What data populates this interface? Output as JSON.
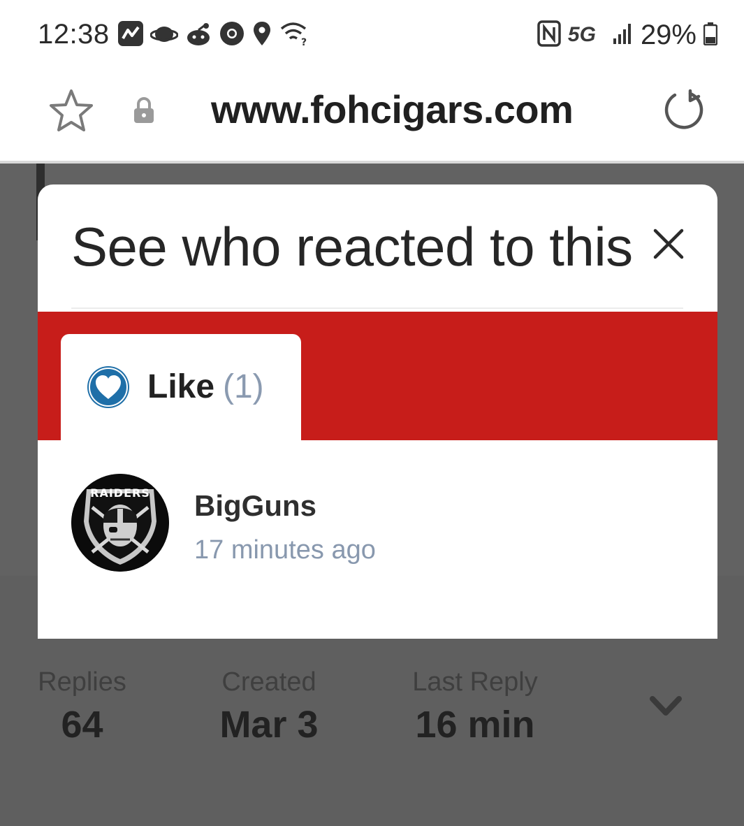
{
  "status_bar": {
    "time": "12:38",
    "left_icons": [
      "activity-app-icon",
      "planet-app-icon",
      "reddit-icon",
      "chrome-icon",
      "location-pin-icon",
      "wifi-question-icon"
    ],
    "network": "5G",
    "battery": "29%",
    "right_icons": [
      "nfc-icon",
      "signal-icon",
      "battery-icon"
    ]
  },
  "browser": {
    "url": "www.fohcigars.com"
  },
  "modal": {
    "title": "See who reacted to this",
    "tabs": [
      {
        "label": "Like",
        "count": "(1)",
        "icon": "heart-icon",
        "color": "#1f6fa8"
      }
    ],
    "reactions": [
      {
        "user": "BigGuns",
        "time": "17 minutes ago",
        "avatar_text": "RAIDERS"
      }
    ]
  },
  "thread_stats": {
    "replies_label": "Replies",
    "replies_value": "64",
    "created_label": "Created",
    "created_value": "Mar 3",
    "last_reply_label": "Last Reply",
    "last_reply_value": "16 min"
  },
  "colors": {
    "tab_strip": "#c71d1a",
    "overlay": "#5f5f5f",
    "muted_text": "#8898ae"
  }
}
